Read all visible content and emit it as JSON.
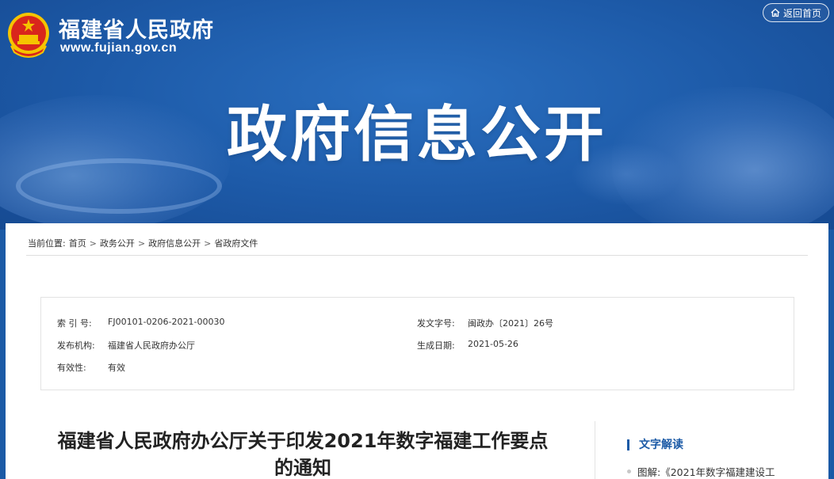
{
  "header": {
    "site_name": "福建省人民政府",
    "site_url": "www.fujian.gov.cn",
    "home_button": "返回首页",
    "banner_title": "政府信息公开"
  },
  "breadcrumb": {
    "prefix": "当前位置:",
    "items": [
      "首页",
      "政务公开",
      "政府信息公开",
      "省政府文件"
    ],
    "separator": ">"
  },
  "meta": {
    "index_label": "索 引 号:",
    "index_value": "FJ00101-0206-2021-00030",
    "doc_no_label": "发文字号:",
    "doc_no_value": "闽政办〔2021〕26号",
    "issuer_label": "发布机构:",
    "issuer_value": "福建省人民政府办公厅",
    "date_label": "生成日期:",
    "date_value": "2021-05-26",
    "validity_label": "有效性:",
    "validity_value": "有效"
  },
  "article": {
    "title_line1": "福建省人民政府办公厅关于印发2021年数字福建工作要点",
    "title_line2": "的通知"
  },
  "sidebar": {
    "section_title": "文字解读",
    "items": [
      "图解:《2021年数字福建建设工"
    ]
  },
  "colors": {
    "brand_blue": "#1b5aa6",
    "emblem_red": "#d9261c",
    "emblem_gold": "#f5c400"
  }
}
